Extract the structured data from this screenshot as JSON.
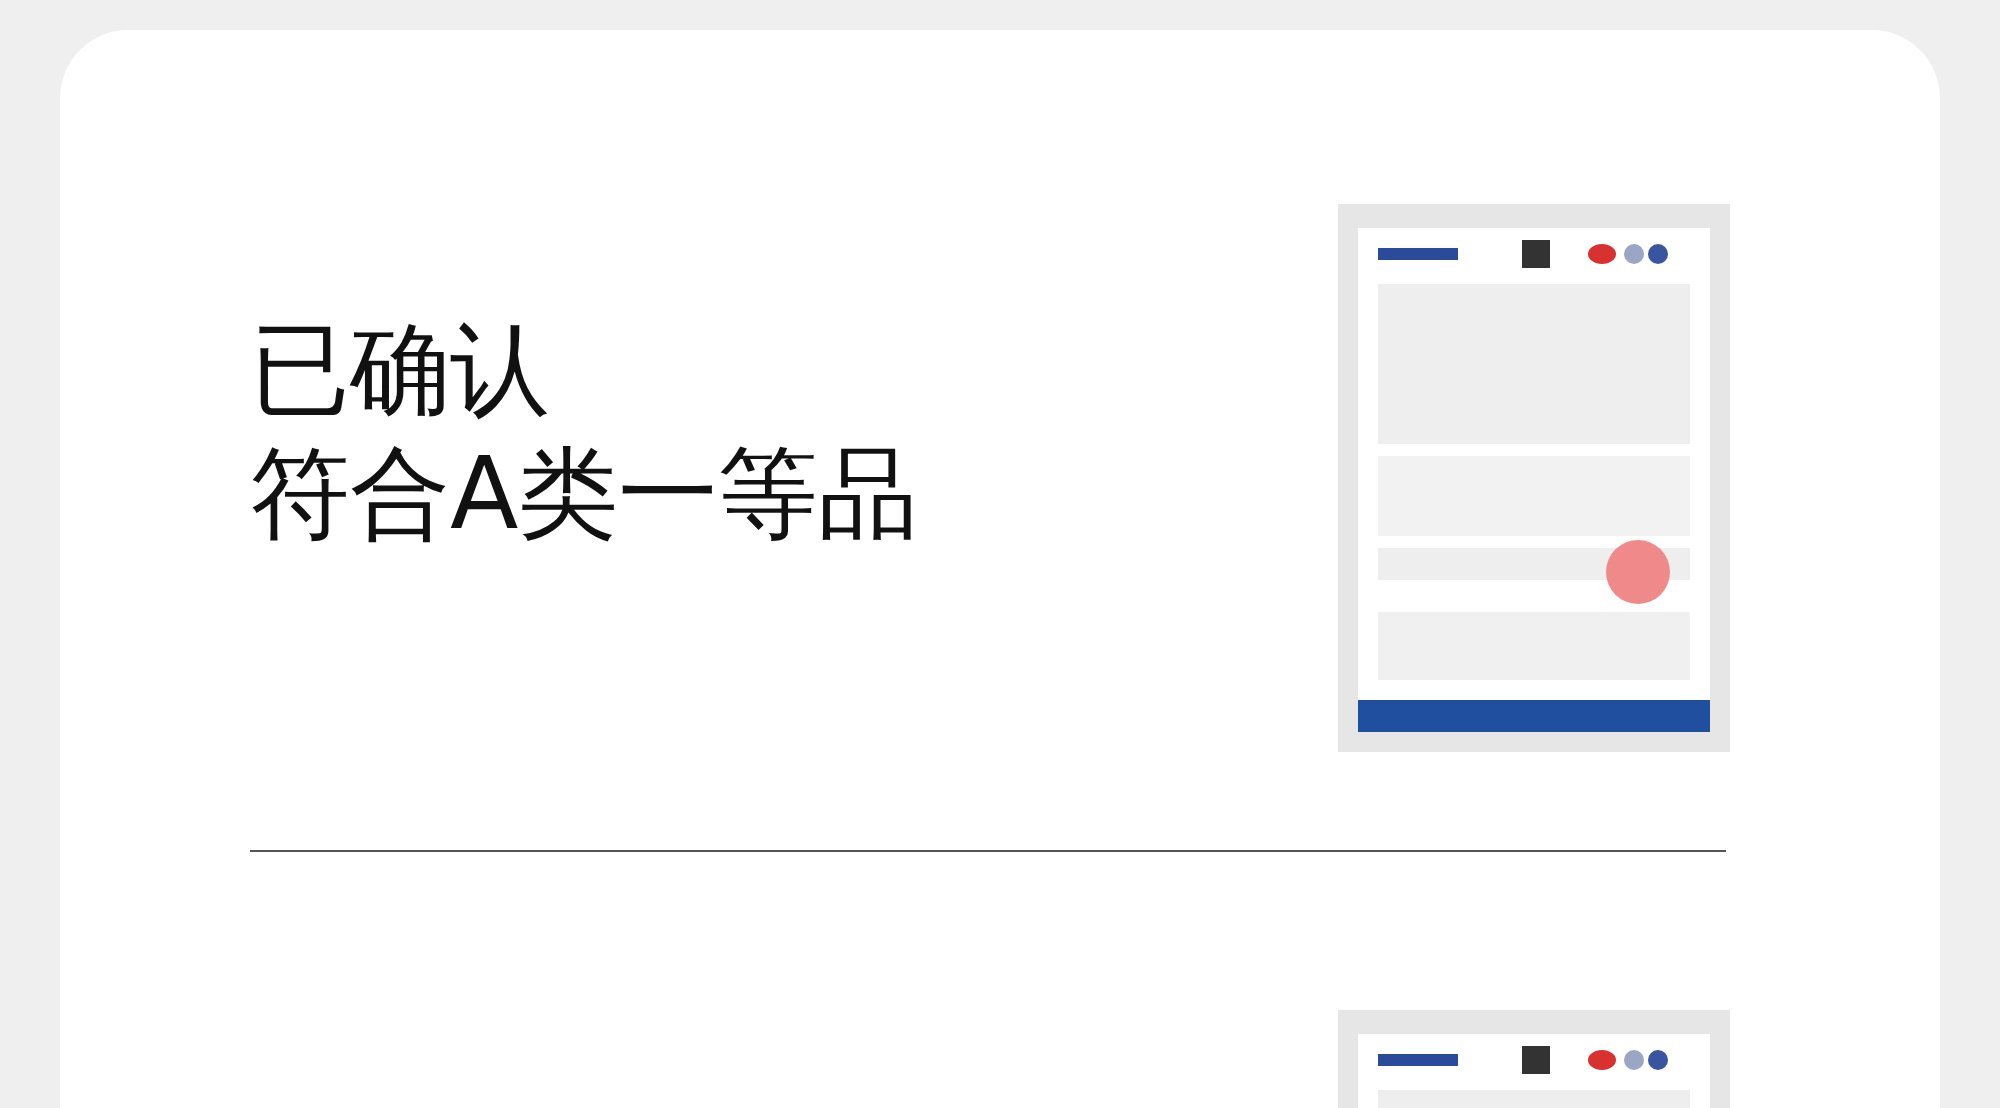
{
  "heading": {
    "lines": [
      "已确认",
      "符合A类一等品"
    ]
  }
}
